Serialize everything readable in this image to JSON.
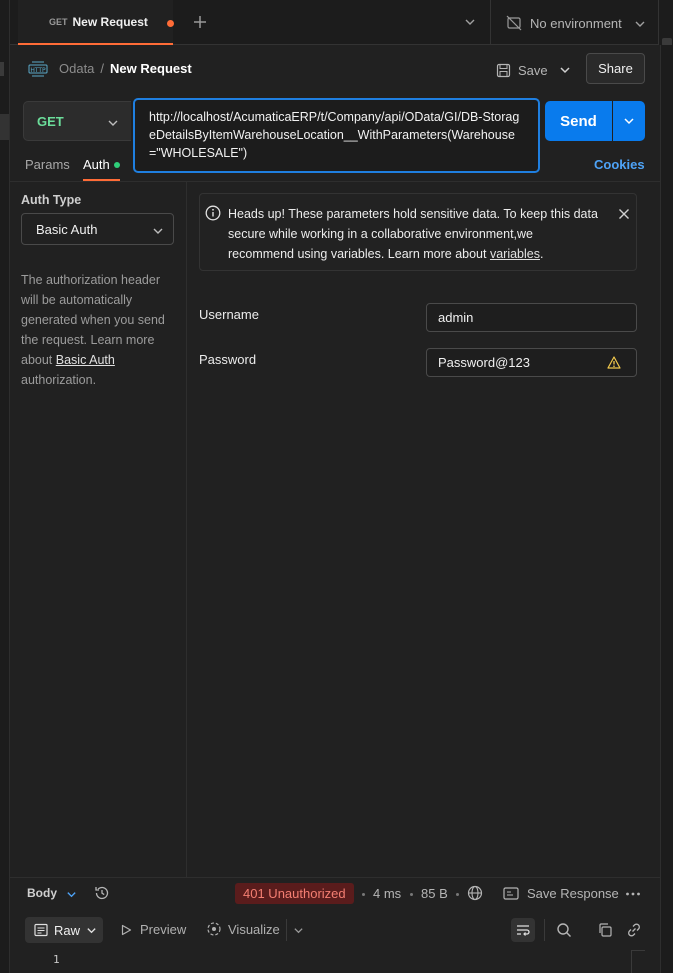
{
  "tab": {
    "method": "GET",
    "title": "New Request"
  },
  "environment": {
    "label": "No environment"
  },
  "breadcrumb": {
    "parent": "Odata",
    "separator": "/",
    "current": "New Request"
  },
  "actions": {
    "save": "Save",
    "share": "Share"
  },
  "request": {
    "method": "GET",
    "url": "http://localhost/AcumaticaERP/t/Company/api/OData/GI/DB-StorageDetailsByItemWarehouseLocation__WithParameters(Warehouse=\"WHOLESALE\")",
    "send": "Send"
  },
  "subtabs": {
    "params": "Params",
    "auth": "Auth",
    "cookies": "Cookies"
  },
  "auth": {
    "type_label": "Auth Type",
    "type_value": "Basic Auth",
    "desc_before": "The authorization header will be automatically generated when you send the request. Learn more about ",
    "desc_link": "Basic Auth",
    "desc_after": " authorization."
  },
  "headsup": {
    "text": "Heads up! These parameters hold sensitive data. To keep this data secure while working in a collaborative environment,we recommend using variables. Learn more about ",
    "link": "variables",
    "end": "."
  },
  "fields": {
    "username_label": "Username",
    "username_value": "admin",
    "password_label": "Password",
    "password_value": "Password@123"
  },
  "response": {
    "body_tab": "Body",
    "status": "401 Unauthorized",
    "time": "4 ms",
    "size": "85 B",
    "save_response": "Save Response",
    "raw": "Raw",
    "preview": "Preview",
    "visualize": "Visualize",
    "line_number": "1"
  },
  "colors": {
    "accent": "#ff6c37",
    "send": "#097bed",
    "method_get": "#6bdd9a",
    "status_error": "#f47e72",
    "focus_border": "#1f7fe0"
  }
}
